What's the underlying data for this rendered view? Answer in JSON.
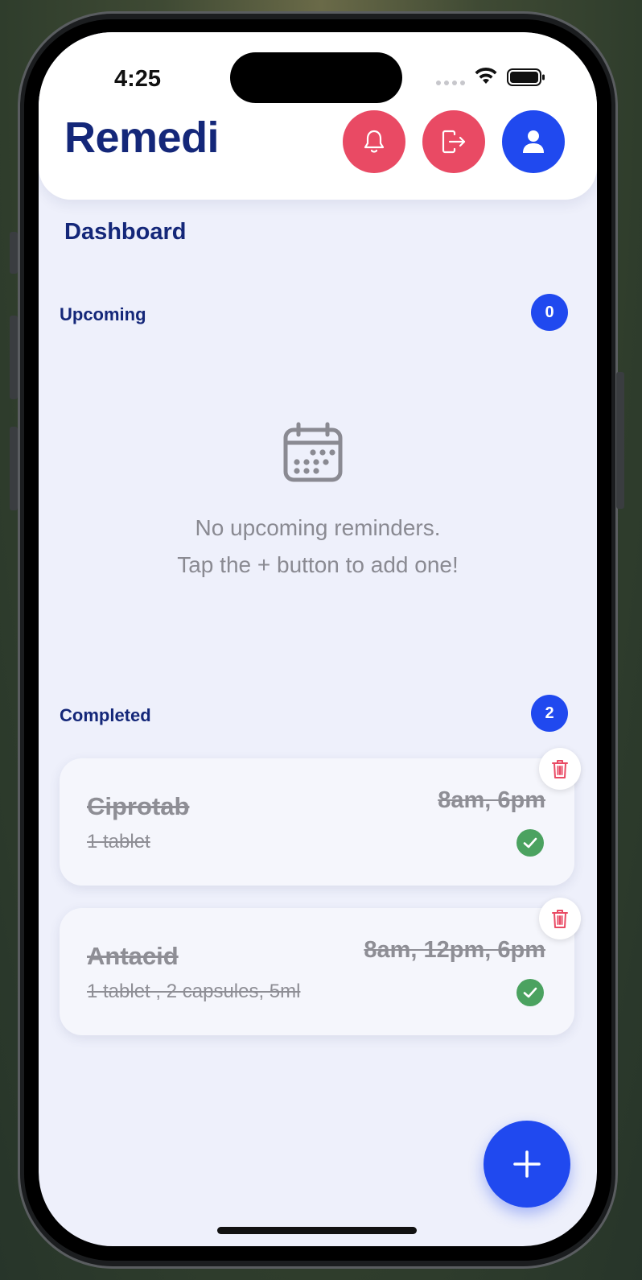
{
  "status_bar": {
    "time": "4:25"
  },
  "header": {
    "app_title": "Remedi",
    "buttons": [
      {
        "name": "notifications",
        "icon": "bell-icon",
        "color": "#e94a64"
      },
      {
        "name": "logout",
        "icon": "logout-icon",
        "color": "#e94a64"
      },
      {
        "name": "profile",
        "icon": "user-icon",
        "color": "#2049ef"
      }
    ]
  },
  "page": {
    "title": "Dashboard"
  },
  "upcoming": {
    "label": "Upcoming",
    "count": "0",
    "empty_icon": "calendar-icon",
    "empty_line1": "No upcoming reminders.",
    "empty_line2": "Tap the + button to add one!"
  },
  "completed": {
    "label": "Completed",
    "count": "2",
    "items": [
      {
        "name": "Ciprotab",
        "dose": "1 tablet",
        "times": "8am, 6pm",
        "status_icon": "check-icon"
      },
      {
        "name": "Antacid",
        "dose": "1 tablet , 2 capsules, 5ml",
        "times": "8am, 12pm, 6pm",
        "status_icon": "check-icon"
      }
    ]
  },
  "fab": {
    "icon": "plus-icon"
  },
  "colors": {
    "brand": "#142779",
    "accent_blue": "#2049ef",
    "accent_red": "#e94a64",
    "success": "#4ba260",
    "background": "#eef0fb"
  }
}
